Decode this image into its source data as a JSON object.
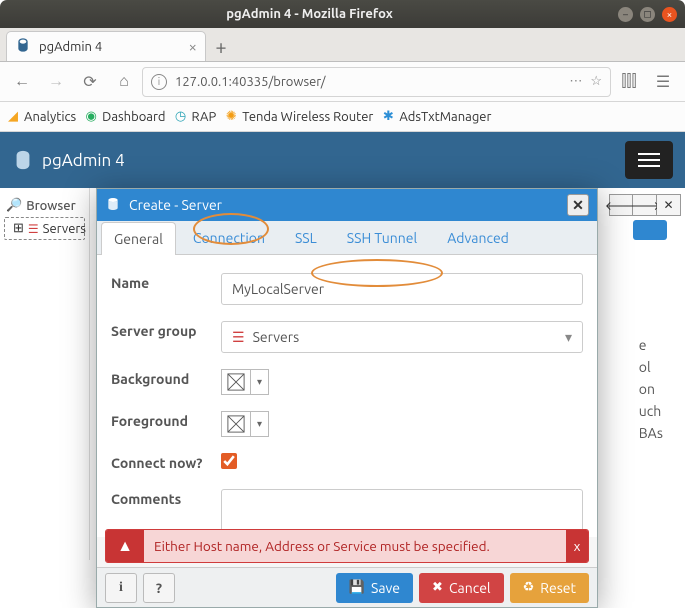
{
  "window": {
    "title": "pgAdmin 4 - Mozilla Firefox"
  },
  "tab": {
    "title": "pgAdmin 4"
  },
  "address": {
    "url": "127.0.0.1:40335/browser/"
  },
  "bookmarks": [
    {
      "label": "Analytics"
    },
    {
      "label": "Dashboard"
    },
    {
      "label": "RAP"
    },
    {
      "label": "Tenda Wireless Router"
    },
    {
      "label": "AdsTxtManager"
    }
  ],
  "pgadmin": {
    "app_name": "pgAdmin 4"
  },
  "sidebar": {
    "header": "Browser",
    "root": "Servers"
  },
  "snippets": {
    "l1": "e",
    "l2": "ol",
    "l3": "on",
    "l4": "uch",
    "l5": "BAs"
  },
  "modal": {
    "title": "Create - Server",
    "tabs": {
      "general": "General",
      "connection": "Connection",
      "ssl": "SSL",
      "ssh": "SSH Tunnel",
      "advanced": "Advanced"
    },
    "labels": {
      "name": "Name",
      "server_group": "Server group",
      "background": "Background",
      "foreground": "Foreground",
      "connect_now": "Connect now?",
      "comments": "Comments"
    },
    "values": {
      "name": "MyLocalServer",
      "server_group": "Servers",
      "connect_now": true,
      "comments": ""
    },
    "alert": "Either Host name, Address or Service must be specified.",
    "buttons": {
      "save": "Save",
      "cancel": "Cancel",
      "reset": "Reset"
    }
  }
}
